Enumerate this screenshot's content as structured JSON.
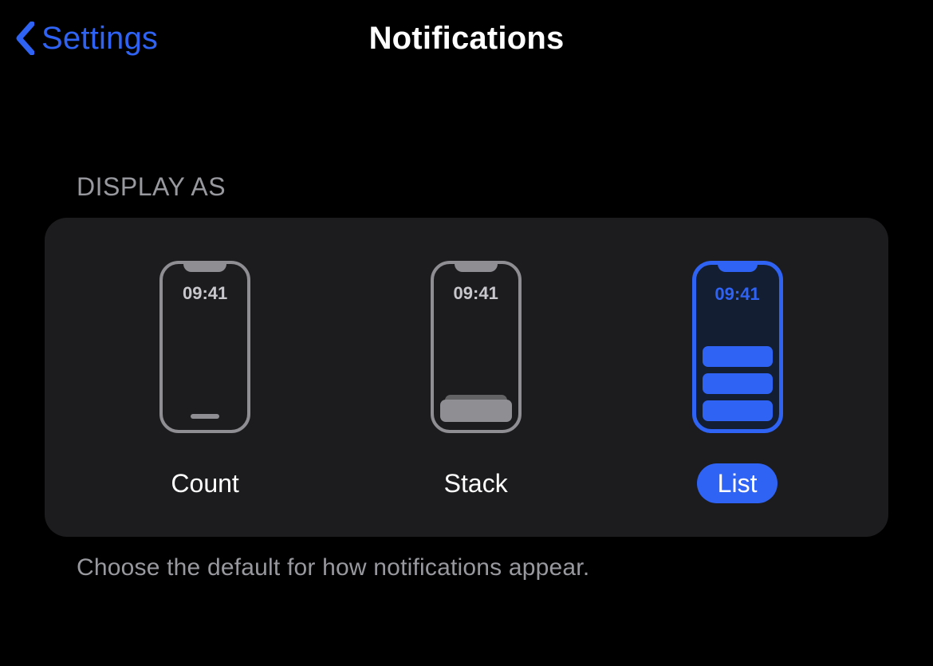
{
  "nav": {
    "back_label": "Settings",
    "title": "Notifications"
  },
  "section": {
    "header": "DISPLAY AS",
    "footer": "Choose the default for how notifications appear."
  },
  "preview_time": "09:41",
  "options": [
    {
      "label": "Count",
      "selected": false
    },
    {
      "label": "Stack",
      "selected": false
    },
    {
      "label": "List",
      "selected": true
    }
  ],
  "colors": {
    "accent": "#2f63f4"
  }
}
